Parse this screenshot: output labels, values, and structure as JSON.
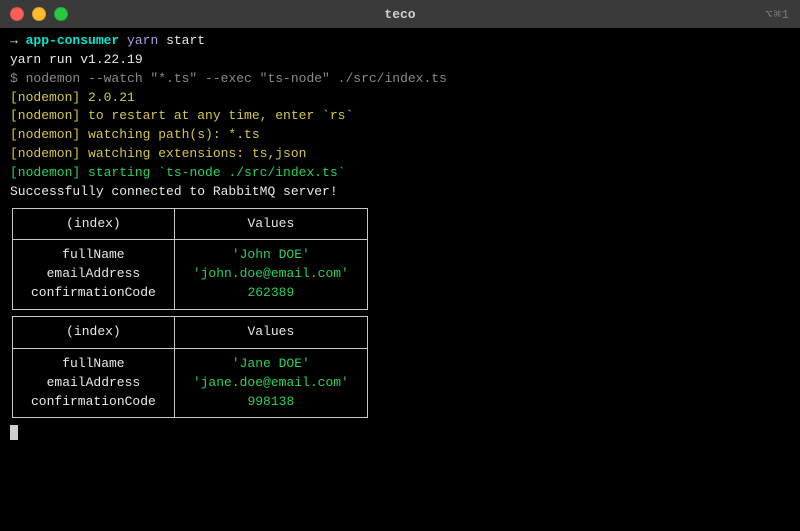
{
  "window": {
    "title": "teco",
    "shortcut": "⌥⌘1"
  },
  "prompt": {
    "arrow": "→ ",
    "dir": "app-consumer",
    "cmd": "yarn",
    "sub": "start"
  },
  "lines": {
    "yarn_run": "yarn run v1.22.19",
    "dollar": "$ ",
    "nodemon_cmd": "nodemon --watch \"*.ts\" --exec \"ts-node\" ./src/index.ts",
    "n1": "[nodemon] 2.0.21",
    "n2": "[nodemon] to restart at any time, enter `rs`",
    "n3": "[nodemon] watching path(s): *.ts",
    "n4": "[nodemon] watching extensions: ts,json",
    "n5a": "[nodemon] starting ",
    "n5b": "`ts-node ./src/index.ts`",
    "connected": "Successfully connected to RabbitMQ server!"
  },
  "table_headers": {
    "index": "(index)",
    "values": "Values"
  },
  "t1": {
    "keys": "fullName\nemailAddress\nconfirmationCode",
    "vals": "'John DOE'\n'john.doe@email.com'\n262389"
  },
  "t2": {
    "keys": "fullName\nemailAddress\nconfirmationCode",
    "vals": "'Jane DOE'\n'jane.doe@email.com'\n998138"
  }
}
